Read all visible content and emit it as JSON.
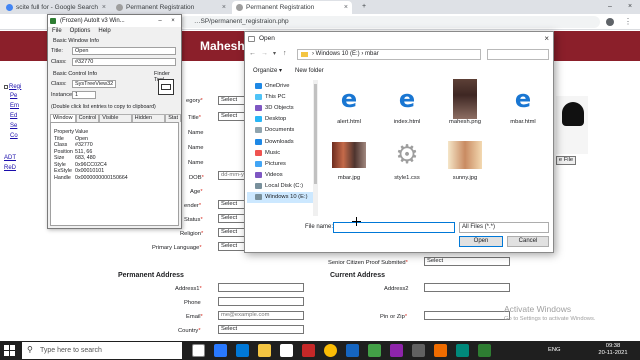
{
  "browser": {
    "tabs": [
      {
        "title": "scite full for - Google Search"
      },
      {
        "title": "Permanent Registration"
      },
      {
        "title": "Permanent Registration"
      }
    ],
    "address": "…SP/permanent_registraion.php",
    "new_tab": "+",
    "close_tab": "×"
  },
  "site": {
    "title": "Mahesh"
  },
  "sidebar": {
    "links": [
      "Regi",
      "Pe",
      "Em",
      "Ed",
      "Se",
      "Co"
    ],
    "links2": [
      "ADT",
      "ReD"
    ]
  },
  "form": {
    "labels": [
      {
        "text": "egory",
        "req": "*"
      },
      {
        "text": "Title",
        "req": "*"
      },
      {
        "text": "Name",
        "req": ""
      },
      {
        "text": "Name",
        "req": ""
      },
      {
        "text": "Name",
        "req": ""
      },
      {
        "text": "DOB",
        "req": "*"
      },
      {
        "text": "Age",
        "req": "*"
      },
      {
        "text": "ender",
        "req": "*"
      },
      {
        "text": "Status",
        "req": "*"
      },
      {
        "text": "Religion",
        "req": "*"
      },
      {
        "text": "Primary Language",
        "req": "*"
      }
    ],
    "select_placeholder": "Select",
    "dob_placeholder": "dd-mm-y",
    "photo_button": "e File",
    "senior_citizen_label": "Senior Citizen Proof Submited",
    "senior_citizen_value": "Select",
    "permanent_address_heading": "Permanent Address",
    "current_address_heading": "Current Address",
    "address1_label": "Address1",
    "address2_label": "Address2",
    "phone_label": "Phone",
    "email_label": "Email",
    "email_placeholder": "me@example.com",
    "pin_label": "Pin or Zip",
    "country_label": "Country",
    "country_value": "Select",
    "required_mark": "*"
  },
  "autoit": {
    "title": "(Frozen) AutoIt v3 Win...",
    "menu": [
      "File",
      "Options",
      "Help"
    ],
    "basic_window_info": "Basic Window Info",
    "title_label": "Title:",
    "title_value": "Open",
    "class_label": "Class:",
    "class_value": "#32770",
    "basic_control_info": "Basic Control Info",
    "finder_tool": "Finder Tool",
    "control_class_label": "Class:",
    "control_class_value": "SysTreeView32",
    "instance_label": "Instance:",
    "instance_value": "1",
    "hint": "(Double click list entries to copy to clipboard)",
    "tabs": [
      "Window",
      "Control",
      "Visible Text",
      "Hidden Text",
      "Stat"
    ],
    "table_header": {
      "k": "Property",
      "v": "Value"
    },
    "rows": [
      {
        "k": "Title",
        "v": "Open"
      },
      {
        "k": "Class",
        "v": "#32770"
      },
      {
        "k": "Position",
        "v": "511, 66"
      },
      {
        "k": "Size",
        "v": "683, 480"
      },
      {
        "k": "Style",
        "v": "0x96CC02C4"
      },
      {
        "k": "ExStyle",
        "v": "0x00010101"
      },
      {
        "k": "Handle",
        "v": "0x0000000000150664"
      }
    ],
    "win_min": "–",
    "win_close": "×"
  },
  "dialog": {
    "title": "Open",
    "path": [
      "Windows 10 (E:)",
      "mbar"
    ],
    "path_sep": "›",
    "organize": "Organize ▾",
    "new_folder": "New folder",
    "nav_items": [
      {
        "label": "OneDrive",
        "color": "#1e88e5",
        "selected": false
      },
      {
        "label": "This PC",
        "color": "#4fc3f7",
        "selected": false
      },
      {
        "label": "3D Objects",
        "color": "#7e57c2",
        "selected": false
      },
      {
        "label": "Desktop",
        "color": "#29b6f6",
        "selected": false
      },
      {
        "label": "Documents",
        "color": "#90a4ae",
        "selected": false
      },
      {
        "label": "Downloads",
        "color": "#1e88e5",
        "selected": false
      },
      {
        "label": "Music",
        "color": "#ef5350",
        "selected": false
      },
      {
        "label": "Pictures",
        "color": "#42a5f5",
        "selected": false
      },
      {
        "label": "Videos",
        "color": "#7e57c2",
        "selected": false
      },
      {
        "label": "Local Disk (C:)",
        "color": "#78909c",
        "selected": false
      },
      {
        "label": "Windows 10 (E:)",
        "color": "#78909c",
        "selected": true
      }
    ],
    "files": [
      {
        "name": "alert.html",
        "kind": "edge"
      },
      {
        "name": "index.html",
        "kind": "edge"
      },
      {
        "name": "mahesh.png",
        "kind": "photo"
      },
      {
        "name": "mbar.html",
        "kind": "edge"
      },
      {
        "name": "mbar.jpg",
        "kind": "jpg"
      },
      {
        "name": "style1.css",
        "kind": "gear"
      },
      {
        "name": "sunny.jpg",
        "kind": "jpg2"
      }
    ],
    "file_name_label": "File name:",
    "file_name_value": "",
    "file_type": "All Files (*.*)",
    "open_button": "Open",
    "cancel_button": "Cancel",
    "close": "×"
  },
  "taskbar": {
    "search_placeholder": "Type here to search",
    "time": "09:38",
    "date": "20-11-2021",
    "lang": "ENG"
  },
  "watermark": {
    "line1": "Activate Windows",
    "line2": "Go to Settings to activate Windows."
  }
}
